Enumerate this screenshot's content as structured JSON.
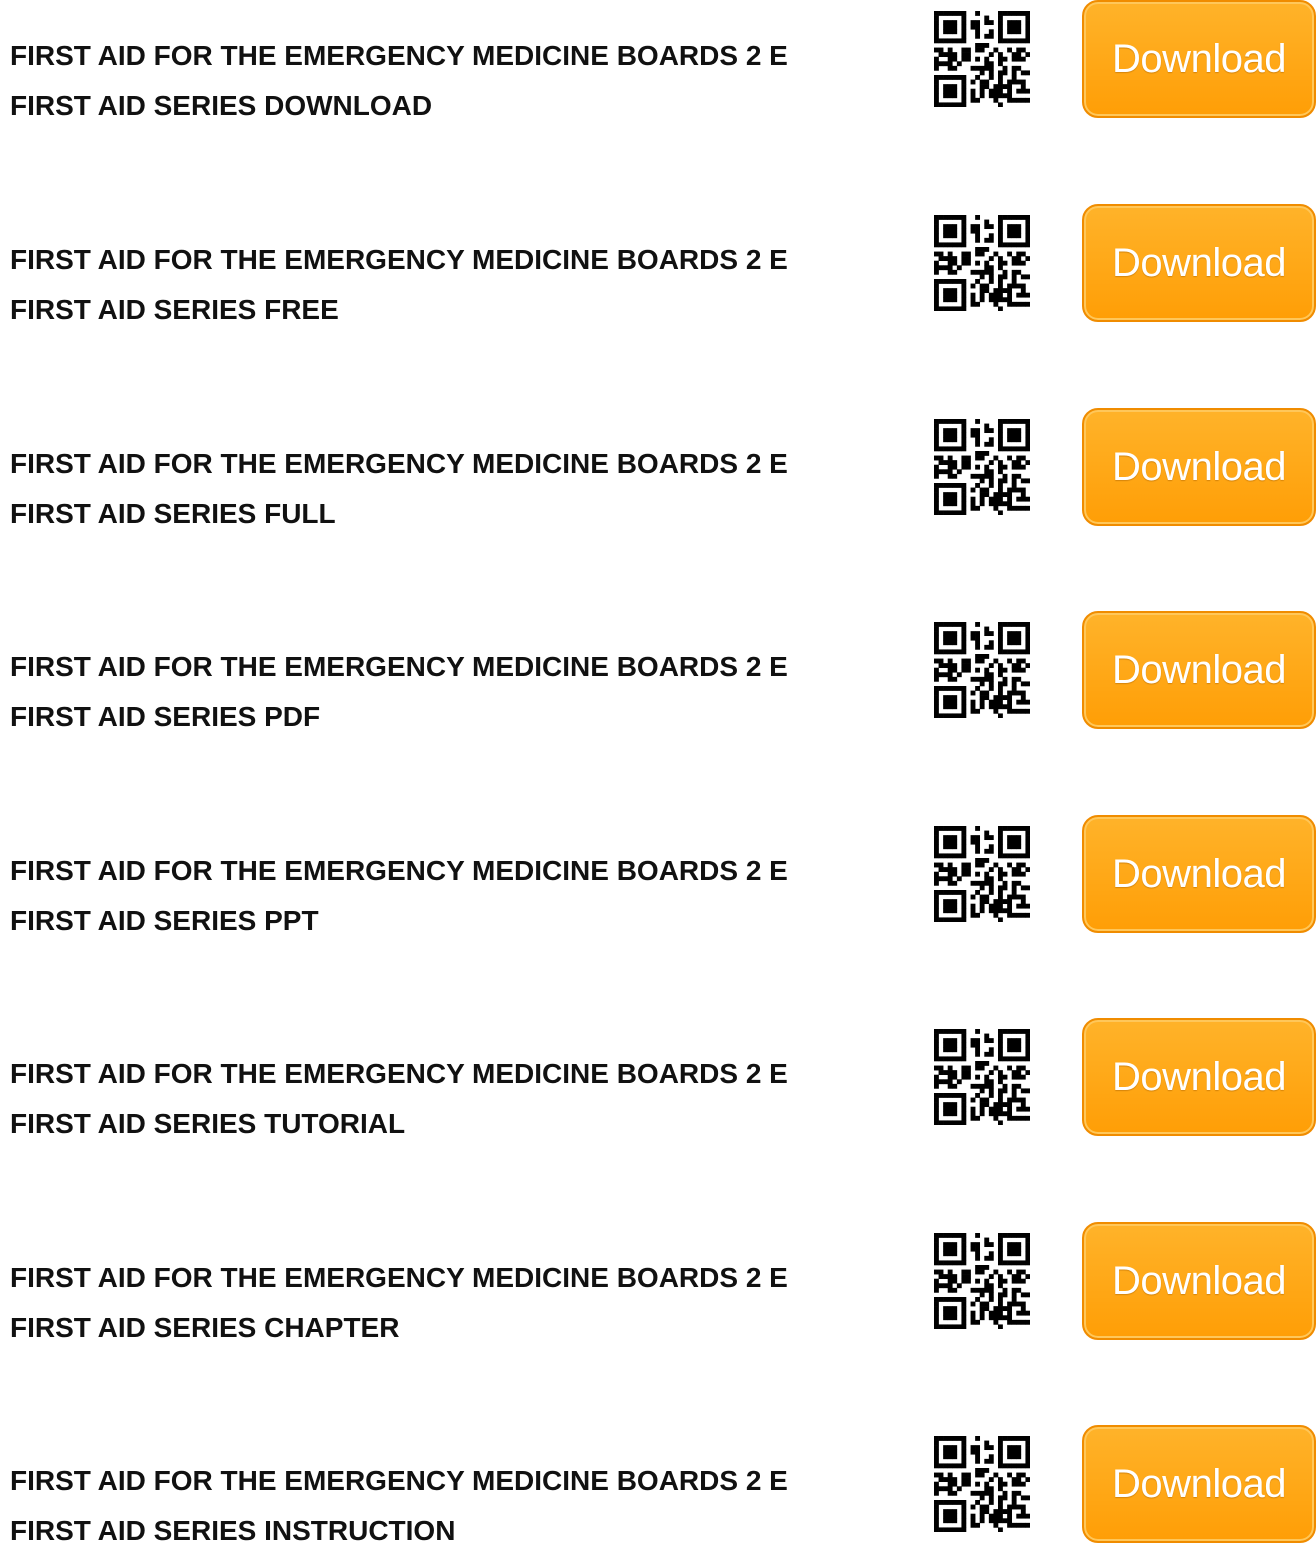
{
  "items": [
    {
      "title_line1": "FIRST AID FOR THE EMERGENCY MEDICINE BOARDS 2 E",
      "title_line2": "FIRST AID SERIES DOWNLOAD",
      "button_label": "Download",
      "icon": "qr-code-icon"
    },
    {
      "title_line1": "FIRST AID FOR THE EMERGENCY MEDICINE BOARDS 2 E",
      "title_line2": "FIRST AID SERIES FREE",
      "button_label": "Download",
      "icon": "qr-code-icon"
    },
    {
      "title_line1": "FIRST AID FOR THE EMERGENCY MEDICINE BOARDS 2 E",
      "title_line2": "FIRST AID SERIES FULL",
      "button_label": "Download",
      "icon": "qr-code-icon"
    },
    {
      "title_line1": "FIRST AID FOR THE EMERGENCY MEDICINE BOARDS 2 E",
      "title_line2": "FIRST AID SERIES PDF",
      "button_label": "Download",
      "icon": "qr-code-icon"
    },
    {
      "title_line1": "FIRST AID FOR THE EMERGENCY MEDICINE BOARDS 2 E",
      "title_line2": "FIRST AID SERIES PPT",
      "button_label": "Download",
      "icon": "qr-code-icon"
    },
    {
      "title_line1": "FIRST AID FOR THE EMERGENCY MEDICINE BOARDS 2 E",
      "title_line2": "FIRST AID SERIES TUTORIAL",
      "button_label": "Download",
      "icon": "qr-code-icon"
    },
    {
      "title_line1": "FIRST AID FOR THE EMERGENCY MEDICINE BOARDS 2 E",
      "title_line2": "FIRST AID SERIES CHAPTER",
      "button_label": "Download",
      "icon": "qr-code-icon"
    },
    {
      "title_line1": "FIRST AID FOR THE EMERGENCY MEDICINE BOARDS 2 E",
      "title_line2": "FIRST AID SERIES INSTRUCTION",
      "button_label": "Download",
      "icon": "qr-code-icon"
    }
  ],
  "colors": {
    "button_orange": "#ff9e06",
    "button_border": "#f08c00",
    "title_text": "#111111",
    "qr_dark": "#000000"
  }
}
